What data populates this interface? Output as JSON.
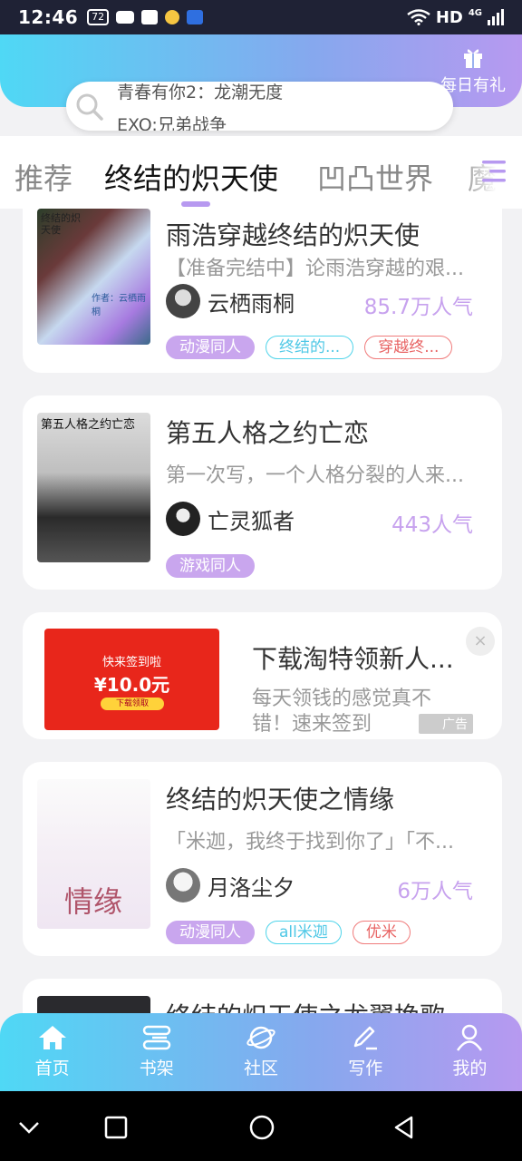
{
  "status_bar": {
    "time": "12:46",
    "battery": "72",
    "network": "HD",
    "network_gen": "4G"
  },
  "header": {
    "gift_label": "每日有礼"
  },
  "search": {
    "lines": [
      "青春有你2：龙潮无度",
      "EXO:兄弟战争"
    ]
  },
  "tabs": [
    "推荐",
    "终结的炽天使",
    "凹凸世界",
    "魔道"
  ],
  "active_tab": 1,
  "books": [
    {
      "title": "雨浩穿越终结的炽天使",
      "desc": "【准备完结中】论雨浩穿越的艰...",
      "author": "云栖雨桐",
      "popularity": "85.7万人气",
      "tags": [
        "动漫同人",
        "终结的...",
        "穿越终..."
      ]
    },
    {
      "title": "第五人格之约亡恋",
      "desc": "第一次写，一个人格分裂的人来...",
      "author": "亡灵狐者",
      "popularity": "443人气",
      "tags": [
        "游戏同人"
      ]
    },
    {
      "title": "终结的炽天使之情缘",
      "desc": "「米迦，我终于找到你了」「不...",
      "author": "月洛尘夕",
      "popularity": "6万人气",
      "tags": [
        "动漫同人",
        "all米迦",
        "优米"
      ]
    },
    {
      "title": "终结的炽天使之龙翼挽歌"
    }
  ],
  "cover_texts": {
    "book1": "终结的炽天使",
    "book1_author": "作者：云栖雨桐",
    "book2": "第五人格之约亡恋",
    "book3": "情缘"
  },
  "ad": {
    "title": "下载淘特领新人...",
    "desc": "每天领钱的感觉真不错！速来签到",
    "badge": "广告",
    "close": "×",
    "image_line1": "快来签到啦",
    "image_amount": "¥10.0元",
    "image_button": "下载领取"
  },
  "bottom_nav": [
    "首页",
    "书架",
    "社区",
    "写作",
    "我的"
  ],
  "colors": {
    "accent_start": "#4fd8f5",
    "accent_end": "#b799f0",
    "popularity": "#c7a2ee"
  }
}
